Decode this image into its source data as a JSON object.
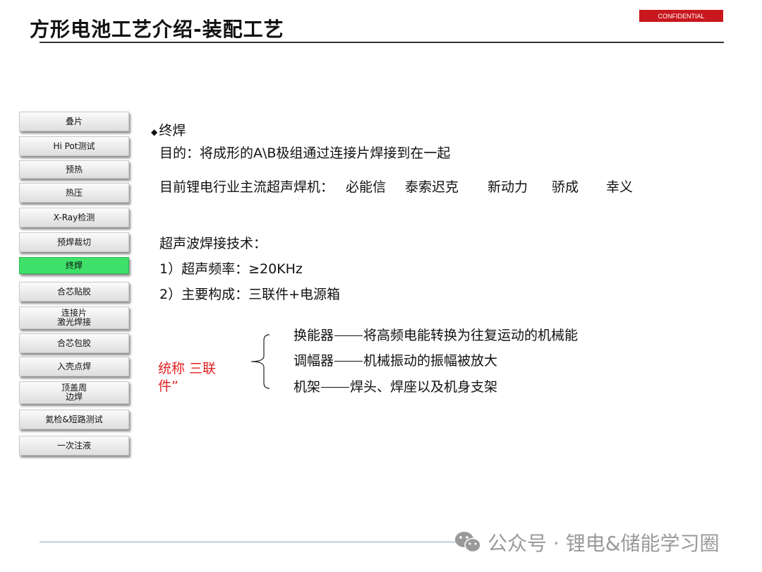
{
  "header": {
    "title": "方形电池工艺介绍-装配工艺",
    "badge": "CONFIDENTIAL"
  },
  "sidebar": {
    "items": [
      {
        "label": "叠片"
      },
      {
        "label": "Hi Pot测试"
      },
      {
        "label": "预热"
      },
      {
        "label": "热压"
      },
      {
        "label": "X-Ray检测"
      },
      {
        "label": "预焊裁切"
      },
      {
        "label": "终焊",
        "active": true
      },
      {
        "label": "合芯贴胶"
      },
      {
        "label": "连接片\n激光焊接"
      },
      {
        "label": "合芯包胶"
      },
      {
        "label": "入壳点焊"
      },
      {
        "label": "顶盖周\n边焊"
      },
      {
        "label": "氦检&短路测试"
      },
      {
        "label": "一次注液"
      }
    ]
  },
  "main": {
    "heading_bullet": "◆",
    "heading": "终焊",
    "purpose": "目的：将成形的A\\B极组通过连接片焊接到在一起",
    "machines_label": "目前锂电行业主流超声焊机：",
    "machines": [
      "必能信",
      "泰索迟克",
      "新动力",
      "骄成",
      "幸义"
    ],
    "tech_title": "超声波焊接技术：",
    "tech_1": "1）超声频率：≥20KHz",
    "tech_2": "2）主要构成：三联件+电源箱",
    "collective_line1": "统称 三联",
    "collective_line2": "件”",
    "components": [
      {
        "name": "换能器",
        "desc": "将高频电能转换为往复运动的机械能"
      },
      {
        "name": "调幅器",
        "desc": "机械振动的振幅被放大"
      },
      {
        "name": "机架",
        "desc": "焊头、焊座以及机身支架"
      }
    ]
  },
  "footer": {
    "watermark": "公众号 · 锂电&储能学习圈"
  },
  "colors": {
    "accent_red": "#c8171d",
    "active_green": "#3ee069",
    "text_red": "#e02020"
  }
}
